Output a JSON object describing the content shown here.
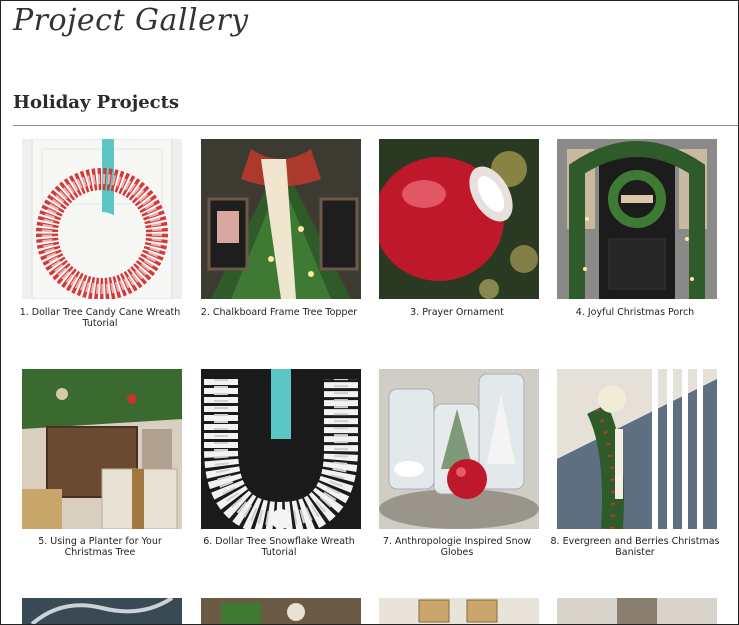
{
  "site_title": "Project Gallery",
  "section_title": "Holiday Projects",
  "projects": [
    {
      "caption": "1. Dollar Tree Candy Cane Wreath Tutorial",
      "image": "candy-cane-wreath"
    },
    {
      "caption": "2. Chalkboard Frame Tree Topper",
      "image": "chalkboard-tree-topper"
    },
    {
      "caption": "3. Prayer Ornament",
      "image": "prayer-ornament"
    },
    {
      "caption": "4. Joyful Christmas Porch",
      "image": "christmas-porch"
    },
    {
      "caption": "5. Using a Planter for Your Christmas Tree",
      "image": "planter-tree"
    },
    {
      "caption": "6. Dollar Tree Snowflake Wreath Tutorial",
      "image": "snowflake-wreath"
    },
    {
      "caption": "7. Anthropologie Inspired Snow Globes",
      "image": "snow-globes"
    },
    {
      "caption": "8. Evergreen and Berries Christmas Banister",
      "image": "christmas-banister"
    },
    {
      "caption": "",
      "image": "partial-row-1"
    },
    {
      "caption": "",
      "image": "partial-row-2"
    },
    {
      "caption": "",
      "image": "partial-row-3"
    },
    {
      "caption": "",
      "image": "partial-row-4"
    }
  ]
}
